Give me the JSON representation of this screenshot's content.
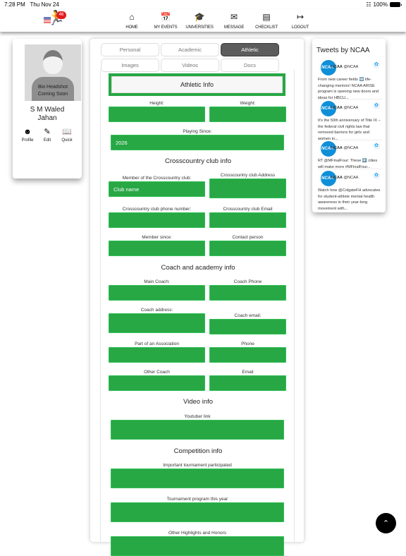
{
  "status_bar": {
    "time": "7:28 PM",
    "date": "Thu Nov 24",
    "battery": "100%"
  },
  "logo": {
    "badge_count": "46",
    "icon": "runner-icon"
  },
  "nav": [
    {
      "label": "HOME",
      "icon": "home-icon"
    },
    {
      "label": "MY EVENTS",
      "icon": "calendar-icon"
    },
    {
      "label": "UNIVERSITIES",
      "icon": "graduation-cap-icon"
    },
    {
      "label": "MESSAGE",
      "icon": "envelope-icon"
    },
    {
      "label": "CHECKLIST",
      "icon": "checklist-icon"
    },
    {
      "label": "LOGOUT",
      "icon": "logout-icon"
    }
  ],
  "profile": {
    "headshot_caption_1": "Bio Headshot",
    "headshot_caption_2": "Coming Soon",
    "name_line1": "S M Waled",
    "name_line2": "Jahan",
    "actions": [
      {
        "label": "Profile",
        "icon": "user-icon"
      },
      {
        "label": "Edit",
        "icon": "pencil-icon"
      },
      {
        "label": "Quick",
        "icon": "book-icon"
      }
    ]
  },
  "tabs": [
    {
      "label": "Personal",
      "active": false
    },
    {
      "label": "Academic",
      "active": false
    },
    {
      "label": "Athletic",
      "active": true
    },
    {
      "label": "Images",
      "active": false
    },
    {
      "label": "Videos",
      "active": false
    },
    {
      "label": "Docs",
      "active": false
    }
  ],
  "form": {
    "title": "Athletic Info",
    "fields": {
      "height": {
        "label": "Height:",
        "value": ""
      },
      "weight": {
        "label": "Weight:",
        "value": ""
      },
      "playing_since": {
        "label": "Playing Since:",
        "value": "2026"
      },
      "club_member": {
        "label": "Member of the Crosscountry club:",
        "value": "Club name"
      },
      "club_address": {
        "label": "Crosscountry club Address",
        "value": ""
      },
      "club_phone": {
        "label": "Crosscountry club phone number:",
        "value": ""
      },
      "club_email": {
        "label": "Crosscountry club Email",
        "value": ""
      },
      "member_since": {
        "label": "Member since:",
        "value": ""
      },
      "contact_person": {
        "label": "Contact person",
        "value": ""
      },
      "main_coach": {
        "label": "Main Coach:",
        "value": ""
      },
      "coach_phone": {
        "label": "Coach Phone",
        "value": ""
      },
      "coach_address": {
        "label": "Coach address:",
        "value": ""
      },
      "coach_email": {
        "label": "Coach email:",
        "value": ""
      },
      "association": {
        "label": "Part of an Association",
        "value": ""
      },
      "phone": {
        "label": "Phone",
        "value": ""
      },
      "other_coach": {
        "label": "Other Coach",
        "value": ""
      },
      "email": {
        "label": "Email",
        "value": ""
      },
      "youtube": {
        "label": "Youtuber link",
        "value": ""
      },
      "tournament": {
        "label": "Important tournament participated",
        "value": ""
      },
      "program": {
        "label": "Tournament program this year",
        "value": ""
      },
      "highlights": {
        "label": "Other Highlights and Honors",
        "value": ""
      }
    },
    "sections": {
      "club": "Crosscountry club info",
      "coach": "Coach and academy info",
      "video": "Video info",
      "competition": "Competition info"
    }
  },
  "tweets": {
    "title": "Tweets by NCAA",
    "items": [
      {
        "name": "NCAA",
        "handle": "@NCAA",
        "avatar": "NCAA",
        "text": "From new career fields ➡️ life-changing mentors! NCAA ARISE program is opening new doors and ideas for HBCU..."
      },
      {
        "name": "NCAA",
        "handle": "@NCAA",
        "avatar": "NCAA",
        "text": "It's the 50th anniversary of Title IX – the federal civil rights law that removed barriers for girls and women in..."
      },
      {
        "name": "NCAA",
        "handle": "@NCAA",
        "avatar": "NCAA",
        "text": "RT @MFinalFour: These 4️⃣ cities will make more #MFinalFour..."
      },
      {
        "name": "NCAA",
        "handle": "@NCAA",
        "avatar": "NCAA",
        "text": "Watch how @ColgateFH advocates for student-athlete mental health awareness in their year-long movement with..."
      }
    ]
  },
  "colors": {
    "field_green": "#28a745",
    "active_tab": "#5c5c5c",
    "badge_red": "#e21c1c",
    "twitter_blue": "#1da1f2"
  }
}
